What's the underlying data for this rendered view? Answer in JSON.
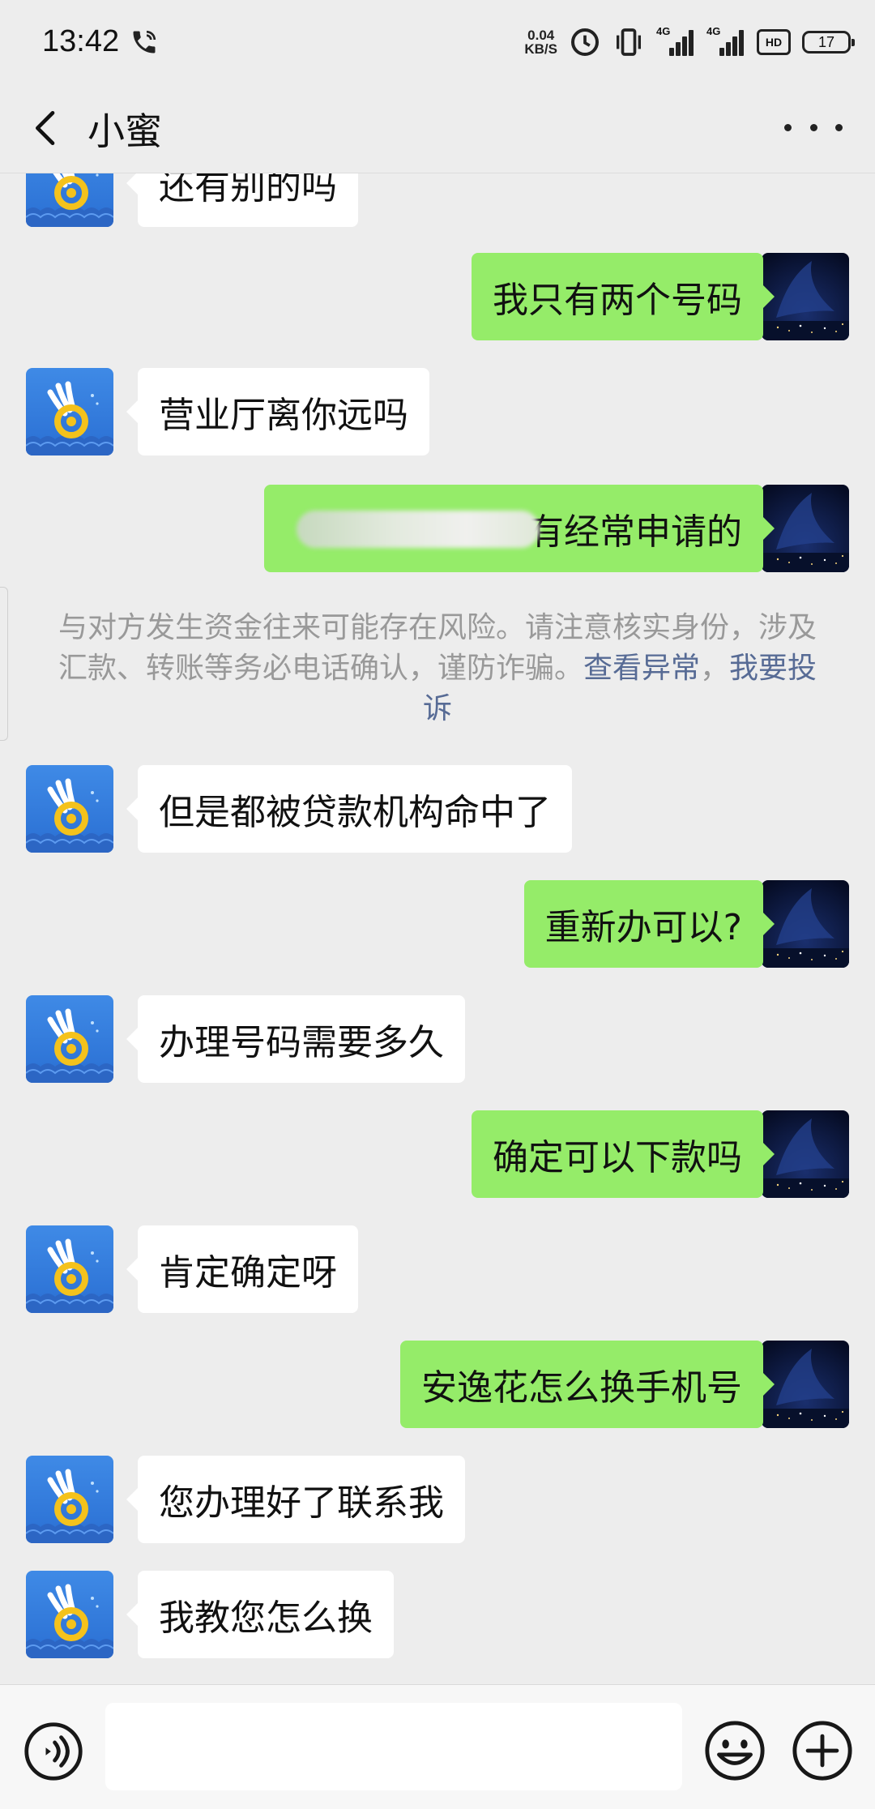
{
  "status_bar": {
    "time": "13:42",
    "net_speed_value": "0.04",
    "net_speed_unit": "KB/S",
    "signal1_tag": "4G",
    "signal2_tag": "4G",
    "hd_label": "HD",
    "battery": "17"
  },
  "header": {
    "title": "小蜜",
    "back_icon": "chevron-left-icon",
    "more_icon": "more-dots-icon"
  },
  "messages": [
    {
      "side": "left",
      "text": "还有别的吗"
    },
    {
      "side": "right",
      "text": "我只有两个号码"
    },
    {
      "side": "left",
      "text": "营业厅离你远吗"
    },
    {
      "side": "right",
      "text": "有经常申请的",
      "partially_obscured": true
    },
    {
      "side": "left",
      "text": "但是都被贷款机构命中了"
    },
    {
      "side": "right",
      "text": "重新办可以?"
    },
    {
      "side": "left",
      "text": "办理号码需要多久"
    },
    {
      "side": "right",
      "text": "确定可以下款吗"
    },
    {
      "side": "left",
      "text": "肯定确定呀"
    },
    {
      "side": "right",
      "text": "安逸花怎么换手机号"
    },
    {
      "side": "left",
      "text": "您办理好了联系我"
    },
    {
      "side": "left",
      "text": "我教您怎么换"
    }
  ],
  "notice": {
    "text": "与对方发生资金往来可能存在风险。请注意核实身份，涉及汇款、转账等务必电话确认，谨防诈骗。",
    "link1": "查看异常",
    "separator": "，",
    "link2": "我要投诉"
  },
  "input_bar": {
    "placeholder": "",
    "value": "",
    "voice_icon": "voice-icon",
    "emoji_icon": "emoji-icon",
    "plus_icon": "plus-icon"
  },
  "colors": {
    "background": "#ededed",
    "sent_bubble": "#95ec69",
    "received_bubble": "#ffffff",
    "link": "#576b95",
    "notice_text": "#999999"
  }
}
